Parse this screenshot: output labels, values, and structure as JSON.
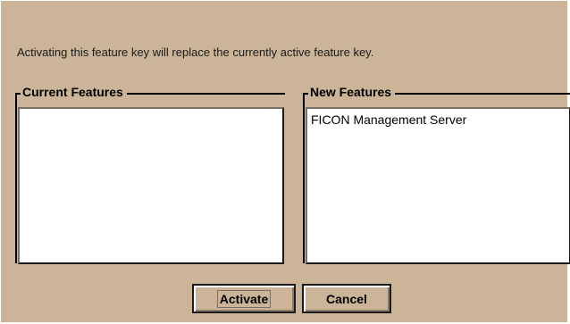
{
  "message": "Activating this feature key will replace the currently active feature key.",
  "current_features": {
    "title": "Current Features",
    "items": []
  },
  "new_features": {
    "title": "New Features",
    "items": [
      "FICON Management Server"
    ]
  },
  "buttons": {
    "activate": "Activate",
    "cancel": "Cancel"
  },
  "colors": {
    "dialog_background": "#cbb498",
    "list_background": "#ffffff"
  }
}
